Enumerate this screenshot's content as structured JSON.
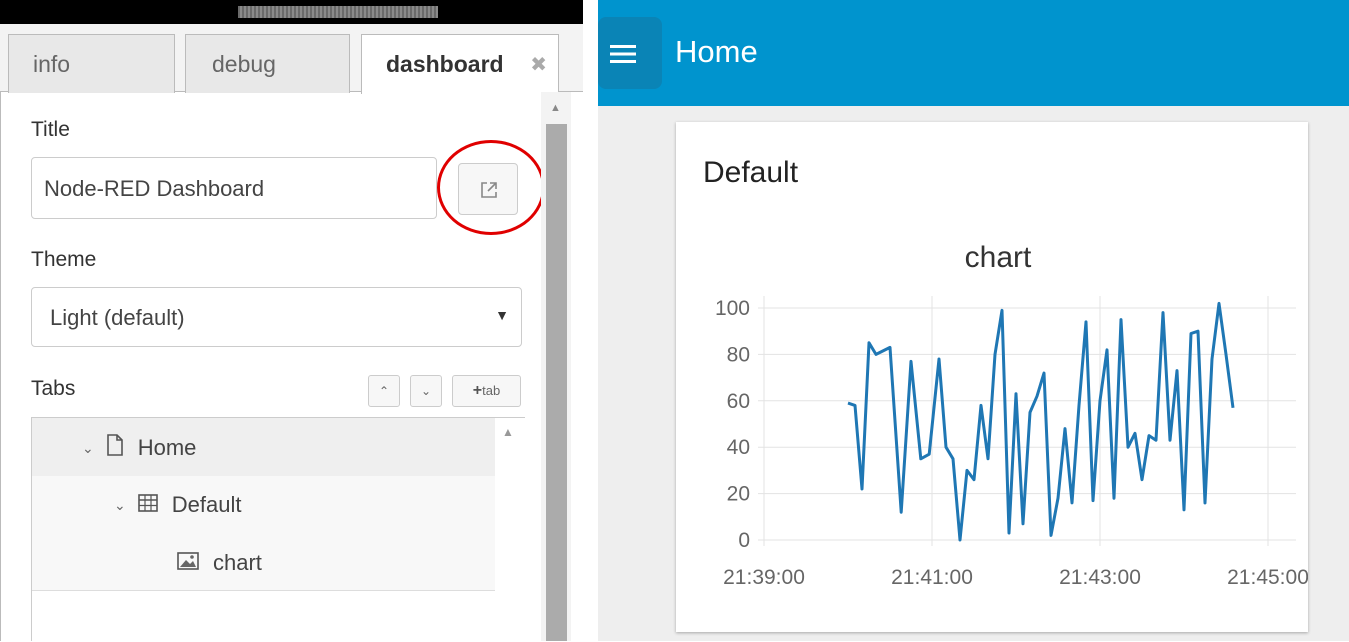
{
  "sidebar": {
    "tabs": [
      {
        "label": "info"
      },
      {
        "label": "debug"
      },
      {
        "label": "dashboard",
        "close": "✖"
      }
    ],
    "title_label": "Title",
    "title_value": "Node-RED Dashboard",
    "theme_label": "Theme",
    "theme_value": "Light (default)",
    "tabs_label": "Tabs",
    "buttons": {
      "up": "⌃",
      "down": "⌄",
      "add_tab": "tab",
      "add_tab_plus": "+"
    },
    "tree": [
      {
        "label": "Home",
        "icon": "file-icon",
        "expanded": true
      },
      {
        "label": "Default",
        "icon": "table-icon",
        "expanded": true
      },
      {
        "label": "chart",
        "icon": "image-icon"
      }
    ],
    "highlight_color": "#e00000"
  },
  "dashboard": {
    "header_title": "Home",
    "header_color": "#0094ce",
    "group_title": "Default",
    "chart_data": {
      "type": "line",
      "title": "chart",
      "xlabel": "",
      "ylabel": "",
      "x_ticks": [
        "21:39:00",
        "21:41:00",
        "21:43:00",
        "21:45:00"
      ],
      "y_ticks": [
        "0",
        "20",
        "40",
        "60",
        "80",
        "100"
      ],
      "xlim": [
        "21:39:00",
        "21:45:20"
      ],
      "ylim": [
        0,
        100
      ],
      "grid": true,
      "color": "#1f77b4",
      "series": [
        {
          "x": [
            "21:40:00",
            "21:40:05",
            "21:40:10",
            "21:40:15",
            "21:40:20",
            "21:40:30",
            "21:40:38",
            "21:40:45",
            "21:40:52",
            "21:40:58",
            "21:41:05",
            "21:41:10",
            "21:41:15",
            "21:41:20",
            "21:41:25",
            "21:41:30",
            "21:41:35",
            "21:41:40",
            "21:41:45",
            "21:41:50",
            "21:41:55",
            "21:42:00",
            "21:42:05",
            "21:42:10",
            "21:42:15",
            "21:42:20",
            "21:42:25",
            "21:42:30",
            "21:42:35",
            "21:42:40",
            "21:42:45",
            "21:42:50",
            "21:42:55",
            "21:43:00",
            "21:43:05",
            "21:43:10",
            "21:43:15",
            "21:43:20",
            "21:43:25",
            "21:43:30",
            "21:43:35",
            "21:43:40",
            "21:43:45",
            "21:43:50",
            "21:43:55",
            "21:44:00",
            "21:44:05",
            "21:44:10",
            "21:44:15",
            "21:44:20",
            "21:44:25",
            "21:44:30",
            "21:44:35",
            "21:44:40",
            "21:44:45",
            "21:44:50",
            "21:44:55"
          ],
          "y": [
            59,
            58,
            22,
            85,
            80,
            83,
            12,
            77,
            35,
            37,
            78,
            40,
            35,
            0,
            30,
            26,
            58,
            35,
            80,
            99,
            3,
            63,
            7,
            55,
            62,
            72,
            2,
            18,
            48,
            16,
            58,
            94,
            17,
            60,
            82,
            18,
            95,
            40,
            46,
            26,
            45,
            43,
            98,
            43,
            73,
            13,
            89,
            90,
            16,
            78,
            102,
            80,
            57
          ]
        }
      ]
    }
  }
}
